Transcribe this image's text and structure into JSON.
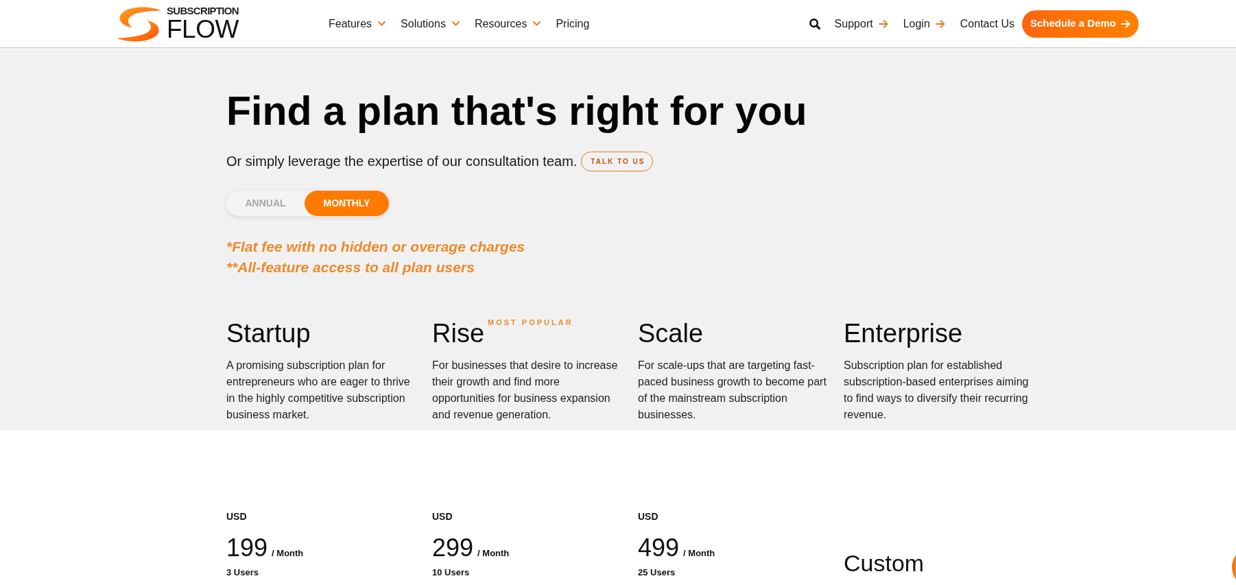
{
  "header": {
    "logo": {
      "line_1": "SUBSCRIPTION",
      "line_2": "FLOW"
    },
    "nav": [
      {
        "label": "Features",
        "kind": "dropdown"
      },
      {
        "label": "Solutions",
        "kind": "dropdown"
      },
      {
        "label": "Resources",
        "kind": "dropdown"
      },
      {
        "label": "Pricing",
        "kind": "link"
      }
    ],
    "actions": [
      {
        "kind": "search"
      },
      {
        "label": "Support",
        "kind": "arrow_link"
      },
      {
        "label": "Login",
        "kind": "arrow_link"
      },
      {
        "label": "Contact Us",
        "kind": "link"
      },
      {
        "label": "Schedule a Demo",
        "kind": "cta"
      }
    ]
  },
  "hero": {
    "title": "Find a plan that's right for you",
    "subtitle": "Or simply leverage the expertise of our consultation team.",
    "talk_button": "TALK TO US",
    "billing_toggle": [
      {
        "label": "ANNUAL",
        "selected": false
      },
      {
        "label": "MONTHLY",
        "selected": true
      }
    ],
    "notes": [
      "*Flat fee with no hidden or overage charges",
      "**All-feature access to all plan users"
    ]
  },
  "plans": [
    {
      "name": "Startup",
      "description": "A promising subscription plan for entrepreneurs who are eager to thrive in the highly competitive subscription business market.",
      "price": {
        "kind": "fixed",
        "currency": "USD",
        "amount": "199",
        "period": "/ Month",
        "users": "3 Users"
      }
    },
    {
      "name": "Rise",
      "badge": "MOST POPULAR",
      "description": "For businesses that desire to increase their growth and find more opportunities for business expansion and revenue generation.",
      "price": {
        "kind": "fixed",
        "currency": "USD",
        "amount": "299",
        "period": "/ Month",
        "users": "10 Users"
      }
    },
    {
      "name": "Scale",
      "description": "For scale-ups that are targeting fast-paced business growth to become part of the mainstream subscription businesses.",
      "price": {
        "kind": "fixed",
        "currency": "USD",
        "amount": "499",
        "period": "/ Month",
        "users": "25 Users"
      }
    },
    {
      "name": "Enterprise",
      "description": "Subscription plan for established subscription-based enterprises aiming to find ways to diversify their recurring revenue.",
      "price": {
        "kind": "custom",
        "label": "Custom"
      }
    }
  ]
}
